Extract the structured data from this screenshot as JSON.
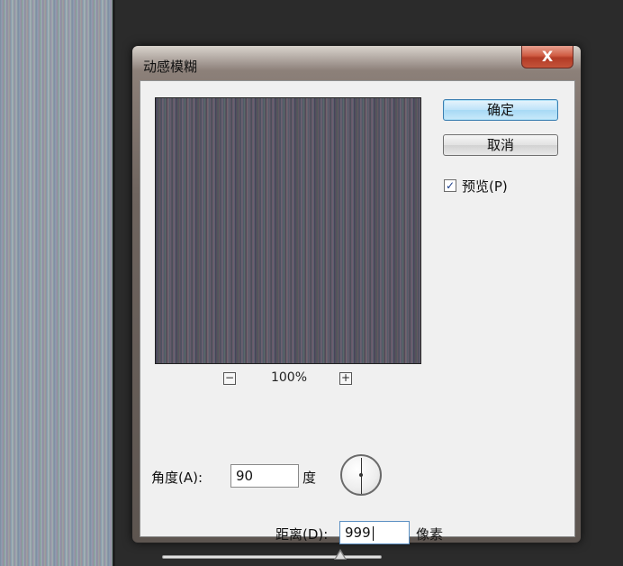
{
  "dialog": {
    "title": "动感模糊",
    "close_label": "X"
  },
  "buttons": {
    "ok": "确定",
    "cancel": "取消"
  },
  "preview": {
    "checkbox_label": "预览(P)",
    "checked": true,
    "check_mark": "✓"
  },
  "zoom": {
    "level": "100%",
    "out_symbol": "−",
    "in_symbol": "+"
  },
  "angle": {
    "label": "角度(A):",
    "value": "90",
    "unit": "度"
  },
  "distance": {
    "label": "距离(D):",
    "value": "999",
    "unit": "像素",
    "slider_fraction": 0.81
  },
  "icons": {
    "close": "close-icon",
    "zoom_out": "minus-icon",
    "zoom_in": "plus-icon",
    "dial": "angle-dial-icon"
  }
}
